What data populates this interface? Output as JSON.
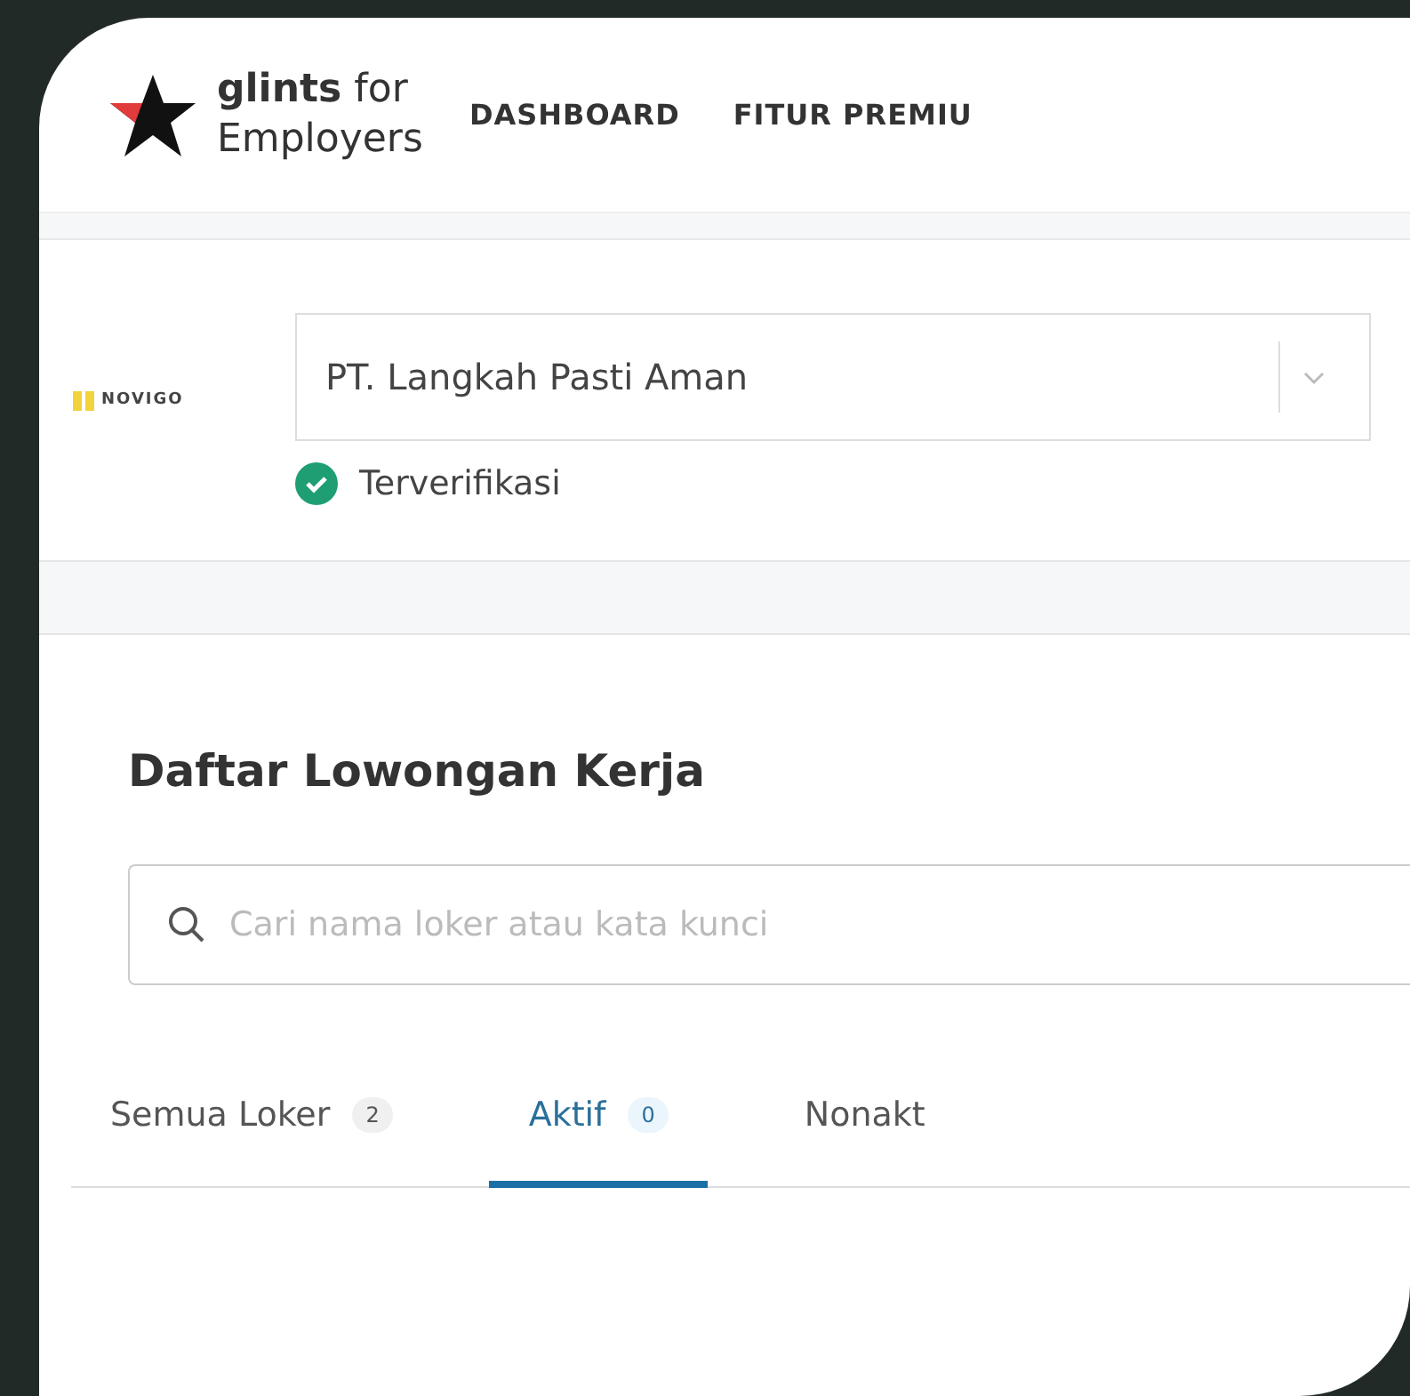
{
  "header": {
    "brand": "glints",
    "brand_suffix": "for",
    "brand_line2": "Employers",
    "nav": [
      {
        "label": "DASHBOARD"
      },
      {
        "label": "FITUR PREMIU"
      }
    ]
  },
  "company": {
    "logo_text": "NOVIGO",
    "name": "PT. Langkah Pasti Aman",
    "verified": true,
    "verified_label": "Terverifikasi"
  },
  "jobs": {
    "title": "Daftar Lowongan Kerja",
    "search": {
      "placeholder": "Cari nama loker atau kata kunci"
    },
    "tabs": [
      {
        "label": "Semua Loker",
        "count": "2",
        "selected": false
      },
      {
        "label": "Aktif",
        "count": "0",
        "selected": true
      },
      {
        "label": "Nonakt",
        "selected": false
      }
    ]
  }
}
